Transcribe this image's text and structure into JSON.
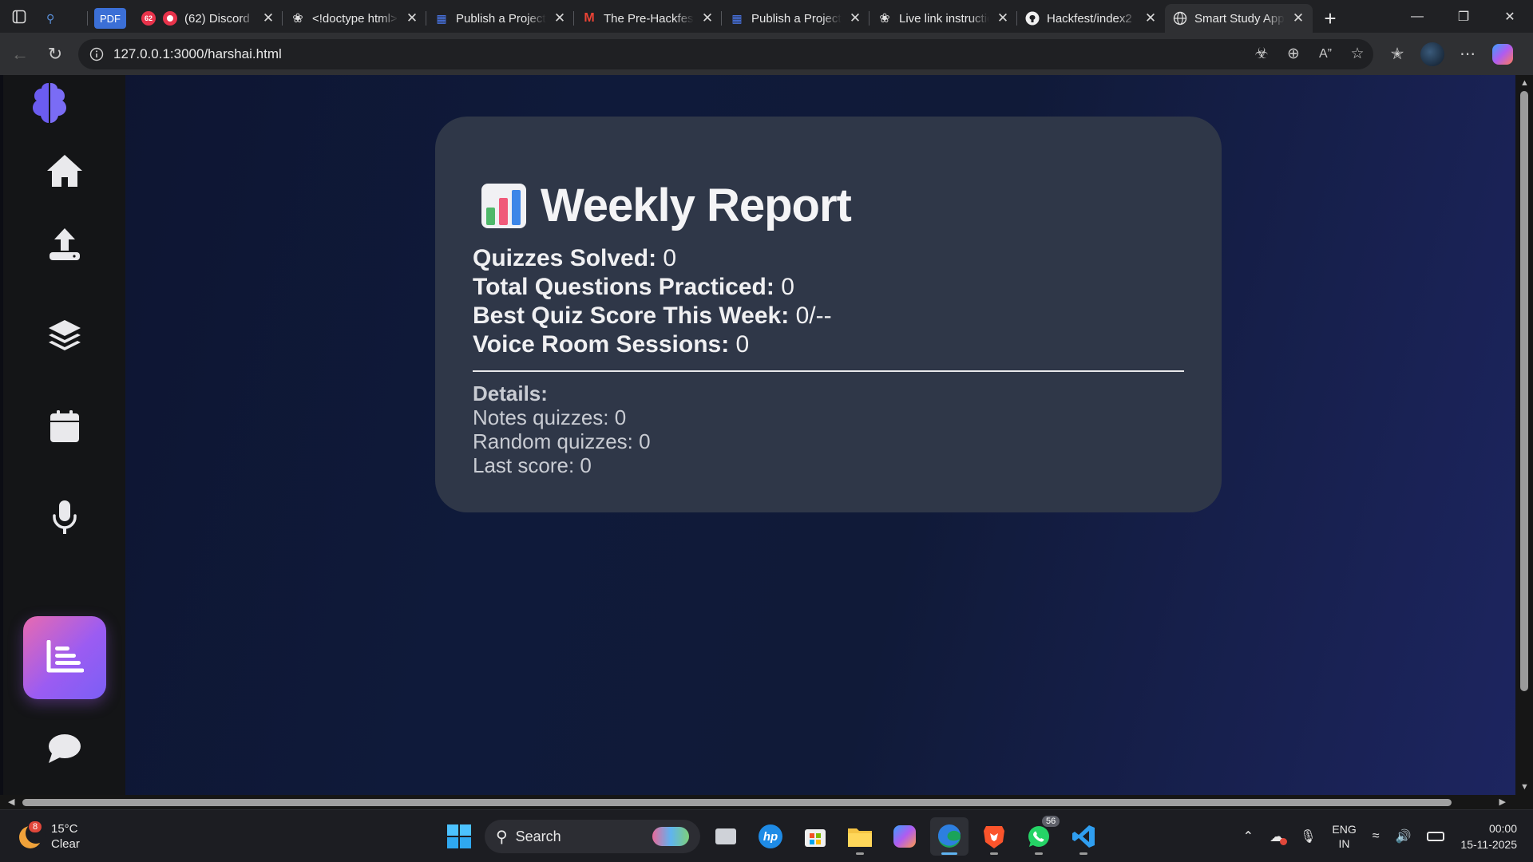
{
  "browser": {
    "tabs": [
      {
        "title": "(62) Discord",
        "badge": "62"
      },
      {
        "title": "<!doctype html>"
      },
      {
        "title": "Publish a Project"
      },
      {
        "title": "The Pre-Hackfest"
      },
      {
        "title": "Publish a Project"
      },
      {
        "title": "Live link instructions"
      },
      {
        "title": "Hackfest/index2"
      },
      {
        "title": "Smart Study App",
        "active": true
      }
    ],
    "pdf_label": "PDF",
    "url": "127.0.0.1:3000/harshai.html"
  },
  "sidebar": {
    "items": [
      {
        "name": "home",
        "icon": "home-icon"
      },
      {
        "name": "upload",
        "icon": "upload-icon"
      },
      {
        "name": "flashcards",
        "icon": "layers-icon"
      },
      {
        "name": "calendar",
        "icon": "calendar-icon"
      },
      {
        "name": "voice-room",
        "icon": "microphone-icon"
      },
      {
        "name": "report",
        "icon": "chart-icon",
        "active": true
      },
      {
        "name": "chat",
        "icon": "chat-bubble-icon"
      }
    ],
    "accent_from": "#e86ab0",
    "accent_to": "#7b5ff5"
  },
  "report": {
    "title": "Weekly Report",
    "stats": [
      {
        "label": "Quizzes Solved:",
        "value": "0"
      },
      {
        "label": "Total Questions Practiced:",
        "value": "0"
      },
      {
        "label": "Best Quiz Score This Week:",
        "value": "0/--"
      },
      {
        "label": "Voice Room Sessions:",
        "value": "0"
      }
    ],
    "details_heading": "Details:",
    "details": [
      "Notes quizzes: 0",
      "Random quizzes: 0",
      "Last score: 0"
    ]
  },
  "taskbar": {
    "weather_temp": "15°C",
    "weather_desc": "Clear",
    "weather_badge": "8",
    "search_label": "Search",
    "whatsapp_badge": "56",
    "lang_line1": "ENG",
    "lang_line2": "IN",
    "time": "00:00",
    "date": "15-11-2025"
  }
}
